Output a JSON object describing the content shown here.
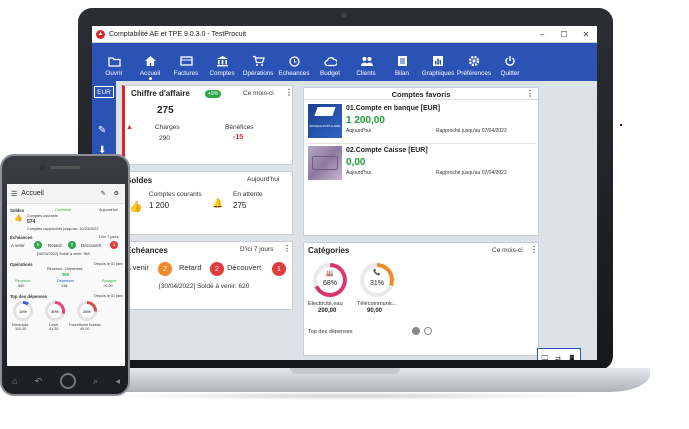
{
  "window": {
    "title": "Comptabilité AE et TPE 9.0.3.0 - TestProcuit",
    "controls": [
      "–",
      "☐",
      "✕"
    ]
  },
  "toolbar": {
    "items": [
      {
        "label": "Ouvrir",
        "icon": "folder-icon"
      },
      {
        "label": "Accueil",
        "icon": "home-icon"
      },
      {
        "label": "Factures",
        "icon": "invoice-icon"
      },
      {
        "label": "Comptes",
        "icon": "bank-icon"
      },
      {
        "label": "Opérations",
        "icon": "cart-icon"
      },
      {
        "label": "Echeances",
        "icon": "alarm-icon"
      },
      {
        "label": "Budget",
        "icon": "cloud-icon"
      },
      {
        "label": "Clients",
        "icon": "users-icon"
      },
      {
        "label": "Bilan",
        "icon": "document-icon"
      },
      {
        "label": "Graphiques",
        "icon": "chart-icon"
      },
      {
        "label": "Préférences",
        "icon": "gear-icon"
      },
      {
        "label": "Quitter",
        "icon": "power-icon"
      }
    ]
  },
  "sidebar": {
    "currency": "EUR"
  },
  "ca_card": {
    "title": "Chiffre d'affaire",
    "badge": "+9%",
    "period": "Ce mois-ci",
    "value": "275",
    "charges_label": "Charges",
    "charges_value": "290",
    "benefices_label": "Bénéfices",
    "benefices_value": "-15"
  },
  "soldes_card": {
    "title": "Soldes",
    "period": "Aujourd'hui",
    "courants_label": "Comptes courants",
    "courants_value": "1 200",
    "attente_label": "En attente",
    "attente_value": "275"
  },
  "echeances_card": {
    "title": "Échéances",
    "period": "D'ici 7 jours",
    "avenir_label": "A venir",
    "avenir_count": "2",
    "retard_label": "Retard",
    "retard_count": "2",
    "decouvert_label": "Découvert",
    "decouvert_count": "1",
    "footer": "[30/04/2022]  Soldé à venir: 620"
  },
  "favoris_card": {
    "title": "Comptes favoris",
    "accounts": [
      {
        "name": "01.Compte en banque  [EUR]",
        "balance": "1 200,00",
        "date_label": "Aujourd'hui",
        "reconciled": "Rapproché jusqu'au 07/04/2022",
        "logo_text": "BANQUE POPULAIRE"
      },
      {
        "name": "02.Compte Caisse  [EUR]",
        "balance": "0,00",
        "date_label": "Aujourd'hui",
        "reconciled": "Rapproché jusqu'au 07/04/2022"
      }
    ]
  },
  "categories_card": {
    "title": "Catégories",
    "period": "Ce mois-ci",
    "items": [
      {
        "percent": "68%",
        "label": "Electricité,eau",
        "value": "200,00",
        "color": "#d9366b"
      },
      {
        "percent": "31%",
        "label": "Télécommunic...",
        "value": "90,00",
        "color": "#f08a28"
      }
    ],
    "footer": "Top des dépenses"
  },
  "switch": {
    "left": "🖵",
    "arrows": "⇄",
    "right": "📱"
  },
  "phone": {
    "title": "Accueil",
    "soldes_title": "Soldes",
    "soldes_status": "Connecté",
    "soldes_period": "Aujourd'hui",
    "soldes_sub": "Comptes courants",
    "soldes_value": "574",
    "soldes_note": "Comptes rapprochés jusqu'au: 10/03/2022",
    "ech_title": "Échéances",
    "ech_period": "D'ici 7 jours",
    "ech_avenir": "A venir",
    "ech_avenir_n": "5",
    "ech_retard": "Retard",
    "ech_retard_n": "0",
    "ech_decouvert": "Découvert",
    "ech_decouvert_n": "1",
    "ech_note": "[16/03/2022]  Solde à venir: 965",
    "ops_title": "Opérations",
    "ops_period": "Depuis le 01 janv",
    "ops_sub": "Revenus - Dépenses",
    "ops_value": "360",
    "rev_label": "Revenus",
    "rev_value": "500",
    "dep_label": "Dépenses",
    "dep_value": "138",
    "epargne_label": "Épargne",
    "epargne_value": "+0,00",
    "top_title": "Top des dépenses",
    "top_period": "Depuis le 01 janv",
    "top_items": [
      {
        "percent": "10%",
        "label": "Electricité",
        "value": "110,00",
        "color": "#3b5bd6"
      },
      {
        "percent": "30%",
        "label": "Loyer",
        "value": "41,30",
        "color": "#e0457b"
      },
      {
        "percent": "26%",
        "label": "Fournitures bureau",
        "value": "40,00",
        "color": "#d94a4a"
      }
    ]
  }
}
